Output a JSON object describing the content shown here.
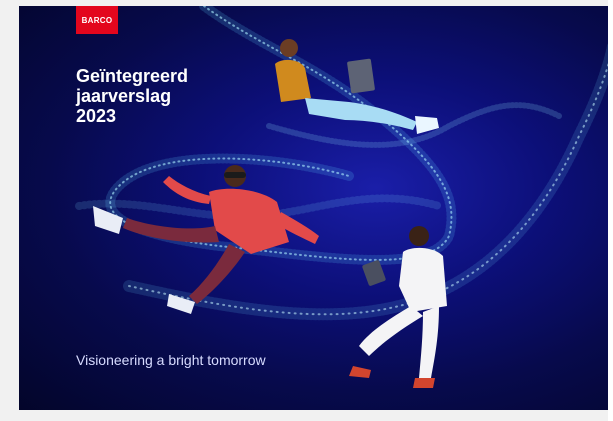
{
  "brand": {
    "logo_text": "BARCO",
    "accent": "#e3061d"
  },
  "cover": {
    "title_lines": [
      "Geïntegreerd",
      "jaarverslag",
      "2023"
    ],
    "tagline": "Visioneering a bright tomorrow",
    "background": "#0c0f78"
  }
}
